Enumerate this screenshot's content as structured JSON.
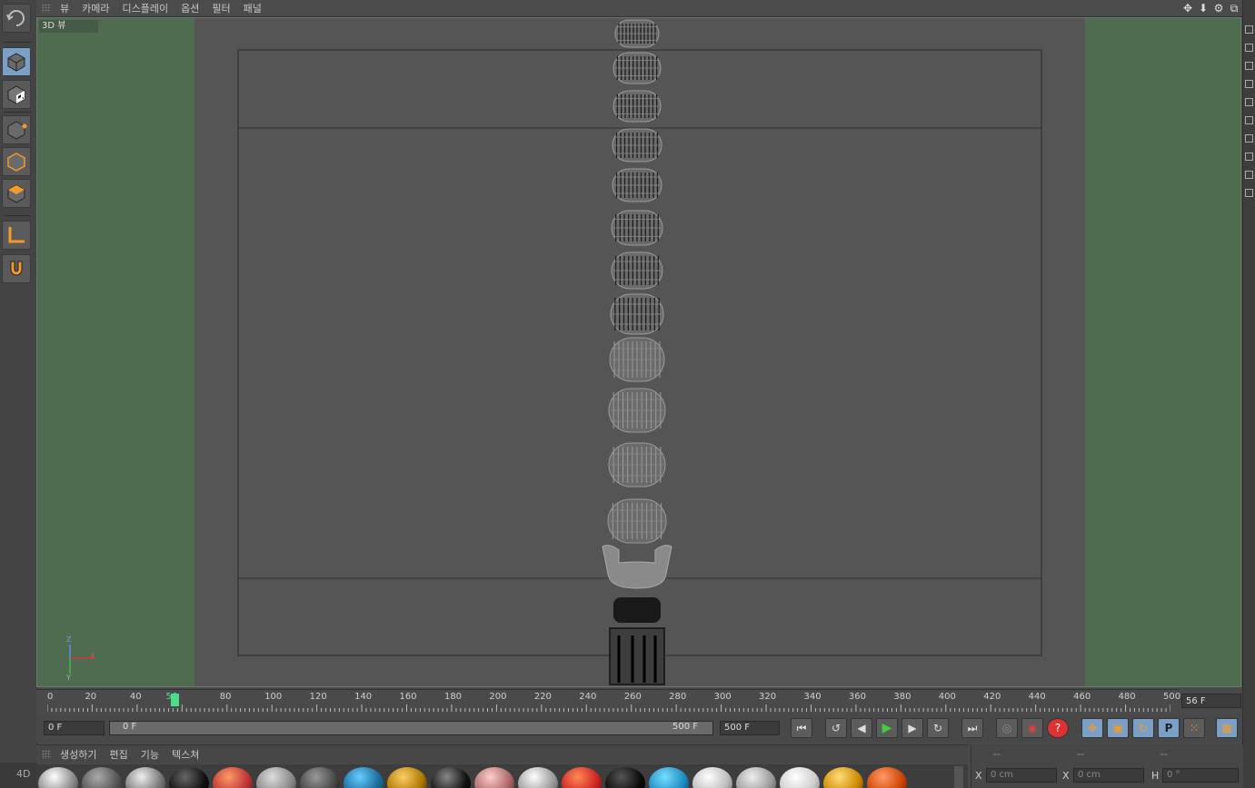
{
  "menu": {
    "items": [
      "뷰",
      "카메라",
      "디스플레이",
      "옵션",
      "필터",
      "패널"
    ]
  },
  "viewport": {
    "label": "3D 뷰",
    "axis_x": "X",
    "axis_y": "Y",
    "axis_z": "Z"
  },
  "timeline": {
    "ticks": [
      "0",
      "20",
      "40",
      "56",
      "80",
      "100",
      "120",
      "140",
      "160",
      "180",
      "200",
      "220",
      "240",
      "260",
      "280",
      "300",
      "320",
      "340",
      "360",
      "380",
      "400",
      "420",
      "440",
      "460",
      "480",
      "500"
    ],
    "current_frame": "56 F"
  },
  "transport": {
    "start_frame": "0 F",
    "range_start": "0 F",
    "range_end": "500 F",
    "end_frame": "500 F"
  },
  "materials": {
    "menu": [
      "생성하기",
      "편집",
      "기능",
      "텍스쳐"
    ]
  },
  "coords": {
    "headers": [
      "--",
      "--",
      "--"
    ],
    "x_label": "X",
    "x_value": "0 cm",
    "x2_label": "X",
    "x2_value": "0 cm",
    "h_label": "H",
    "h_value": "0 °"
  },
  "brand": "4D",
  "colors": {
    "viewport_bg": "#4f6b50",
    "grid_area": "#555555",
    "accent_blue": "#7aa0c8",
    "timeline_marker": "#4ddc8a",
    "play_green": "#3bd13b"
  }
}
